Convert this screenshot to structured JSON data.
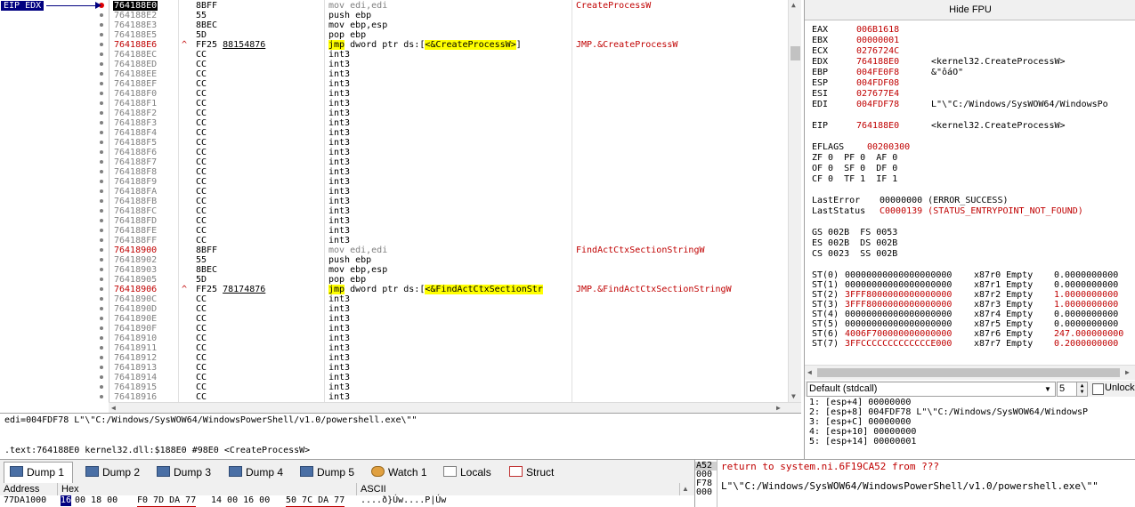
{
  "eip_tag": "EIP EDX",
  "disasm": [
    {
      "addr": "764188E0",
      "bytes": "8BFF",
      "instr": "mov edi,edi",
      "comment": "CreateProcessW",
      "cur": true,
      "bp": true,
      "gray": true
    },
    {
      "addr": "764188E2",
      "bytes": "55",
      "instr": "push ebp"
    },
    {
      "addr": "764188E3",
      "bytes": "8BEC",
      "instr": "mov ebp,esp"
    },
    {
      "addr": "764188E5",
      "bytes": "5D",
      "instr": "pop ebp"
    },
    {
      "addr": "764188E6",
      "bytes": "FF25 ",
      "bytes_ann": "88154876",
      "instr_kw": "jmp",
      "instr": " dword ptr ds:[",
      "instr_lbl": "<&CreateProcessW>",
      "instr_tail": "]",
      "comment": "JMP.&CreateProcessW",
      "jmp": true
    },
    {
      "addr": "764188EC",
      "bytes": "CC",
      "instr": "int3"
    },
    {
      "addr": "764188ED",
      "bytes": "CC",
      "instr": "int3"
    },
    {
      "addr": "764188EE",
      "bytes": "CC",
      "instr": "int3"
    },
    {
      "addr": "764188EF",
      "bytes": "CC",
      "instr": "int3"
    },
    {
      "addr": "764188F0",
      "bytes": "CC",
      "instr": "int3"
    },
    {
      "addr": "764188F1",
      "bytes": "CC",
      "instr": "int3"
    },
    {
      "addr": "764188F2",
      "bytes": "CC",
      "instr": "int3"
    },
    {
      "addr": "764188F3",
      "bytes": "CC",
      "instr": "int3"
    },
    {
      "addr": "764188F4",
      "bytes": "CC",
      "instr": "int3"
    },
    {
      "addr": "764188F5",
      "bytes": "CC",
      "instr": "int3"
    },
    {
      "addr": "764188F6",
      "bytes": "CC",
      "instr": "int3"
    },
    {
      "addr": "764188F7",
      "bytes": "CC",
      "instr": "int3"
    },
    {
      "addr": "764188F8",
      "bytes": "CC",
      "instr": "int3"
    },
    {
      "addr": "764188F9",
      "bytes": "CC",
      "instr": "int3"
    },
    {
      "addr": "764188FA",
      "bytes": "CC",
      "instr": "int3"
    },
    {
      "addr": "764188FB",
      "bytes": "CC",
      "instr": "int3"
    },
    {
      "addr": "764188FC",
      "bytes": "CC",
      "instr": "int3"
    },
    {
      "addr": "764188FD",
      "bytes": "CC",
      "instr": "int3"
    },
    {
      "addr": "764188FE",
      "bytes": "CC",
      "instr": "int3"
    },
    {
      "addr": "764188FF",
      "bytes": "CC",
      "instr": "int3"
    },
    {
      "addr": "76418900",
      "bytes": "8BFF",
      "instr": "mov edi,edi",
      "comment": "FindActCtxSectionStringW",
      "jmp": true,
      "gray": true
    },
    {
      "addr": "76418902",
      "bytes": "55",
      "instr": "push ebp"
    },
    {
      "addr": "76418903",
      "bytes": "8BEC",
      "instr": "mov ebp,esp"
    },
    {
      "addr": "76418905",
      "bytes": "5D",
      "instr": "pop ebp"
    },
    {
      "addr": "76418906",
      "bytes": "FF25 ",
      "bytes_ann": "78174876",
      "instr_kw": "jmp",
      "instr": " dword ptr ds:[",
      "instr_lbl": "<&FindActCtxSectionStr",
      "instr_tail": "",
      "comment": "JMP.&FindActCtxSectionStringW",
      "jmp": true
    },
    {
      "addr": "7641890C",
      "bytes": "CC",
      "instr": "int3"
    },
    {
      "addr": "7641890D",
      "bytes": "CC",
      "instr": "int3"
    },
    {
      "addr": "7641890E",
      "bytes": "CC",
      "instr": "int3"
    },
    {
      "addr": "7641890F",
      "bytes": "CC",
      "instr": "int3"
    },
    {
      "addr": "76418910",
      "bytes": "CC",
      "instr": "int3"
    },
    {
      "addr": "76418911",
      "bytes": "CC",
      "instr": "int3"
    },
    {
      "addr": "76418912",
      "bytes": "CC",
      "instr": "int3"
    },
    {
      "addr": "76418913",
      "bytes": "CC",
      "instr": "int3"
    },
    {
      "addr": "76418914",
      "bytes": "CC",
      "instr": "int3"
    },
    {
      "addr": "76418915",
      "bytes": "CC",
      "instr": "int3"
    },
    {
      "addr": "76418916",
      "bytes": "CC",
      "instr": "int3"
    }
  ],
  "info": {
    "line1": "edi=004FDF78 L\"\\\"C:/Windows/SysWOW64/WindowsPowerShell/v1.0/powershell.exe\\\"\"",
    "line2": ".text:764188E0 kernel32.dll:$188E0 #98E0 <CreateProcessW>"
  },
  "registers": {
    "hide_fpu": "Hide FPU",
    "gp": [
      {
        "name": "EAX",
        "value": "006B1618",
        "comment": ""
      },
      {
        "name": "EBX",
        "value": "00000001",
        "comment": ""
      },
      {
        "name": "ECX",
        "value": "0276724C",
        "comment": ""
      },
      {
        "name": "EDX",
        "value": "764188E0",
        "comment": "<kernel32.CreateProcessW>"
      },
      {
        "name": "EBP",
        "value": "004FE0F8",
        "comment": "&\"ôáO\""
      },
      {
        "name": "ESP",
        "value": "004FDF08",
        "comment": ""
      },
      {
        "name": "ESI",
        "value": "027677E4",
        "comment": ""
      },
      {
        "name": "EDI",
        "value": "004FDF78",
        "comment": "L\"\\\"C:/Windows/SysWOW64/WindowsPo"
      }
    ],
    "eip": {
      "name": "EIP",
      "value": "764188E0",
      "comment": "<kernel32.CreateProcessW>"
    },
    "eflags": {
      "name": "EFLAGS",
      "value": "00200300"
    },
    "flags": [
      "ZF 0  PF 0  AF 0",
      "OF 0  SF 0  DF 0",
      "CF 0  TF 1  IF 1"
    ],
    "lasterror_label": "LastError",
    "lasterror_value": "00000000 (ERROR_SUCCESS)",
    "laststatus_label": "LastStatus",
    "laststatus_value": "C0000139 (STATUS_ENTRYPOINT_NOT_FOUND)",
    "segs": [
      "GS 002B  FS 0053",
      "ES 002B  DS 002B",
      "CS 0023  SS 002B"
    ],
    "fpu": [
      {
        "name": "ST(0)",
        "value": "00000000000000000000",
        "tag": "x87r0 Empty",
        "num": "0.0000000000",
        "red": false
      },
      {
        "name": "ST(1)",
        "value": "00000000000000000000",
        "tag": "x87r1 Empty",
        "num": "0.0000000000",
        "red": false
      },
      {
        "name": "ST(2)",
        "value": "3FFF8000000000000000",
        "tag": "x87r2 Empty",
        "num": "1.0000000000",
        "red": true
      },
      {
        "name": "ST(3)",
        "value": "3FFF8000000000000000",
        "tag": "x87r3 Empty",
        "num": "1.0000000000",
        "red": true
      },
      {
        "name": "ST(4)",
        "value": "00000000000000000000",
        "tag": "x87r4 Empty",
        "num": "0.0000000000",
        "red": false
      },
      {
        "name": "ST(5)",
        "value": "00000000000000000000",
        "tag": "x87r5 Empty",
        "num": "0.0000000000",
        "red": false
      },
      {
        "name": "ST(6)",
        "value": "4006F700000000000000",
        "tag": "x87r6 Empty",
        "num": "247.000000000",
        "red": true
      },
      {
        "name": "ST(7)",
        "value": "3FFCCCCCCCCCCCCCE000",
        "tag": "x87r7 Empty",
        "num": "0.2000000000",
        "red": true
      }
    ]
  },
  "callstack": {
    "convention": "Default (stdcall)",
    "arg_count": "5",
    "unlock_label": "Unlock",
    "rows": [
      "1: [esp+4] 00000000",
      "2: [esp+8] 004FDF78 L\"\\\"C:/Windows/SysWOW64/WindowsP",
      "3: [esp+C] 00000000",
      "4: [esp+10] 00000000",
      "5: [esp+14] 00000001"
    ]
  },
  "tabs": [
    "Dump 1",
    "Dump 2",
    "Dump 3",
    "Dump 4",
    "Dump 5",
    "Watch 1",
    "Locals",
    "Struct"
  ],
  "dump": {
    "col_address": "Address",
    "col_hex": "Hex",
    "col_ascii": "ASCII",
    "row_addr": "77DA1000",
    "hex_groups": [
      "16 00 18 00",
      "F0 7D DA 77",
      "14 00 16 00",
      "50 7C DA 77"
    ],
    "ascii": "....ð}Úw....P|Úw"
  },
  "stack": {
    "addr_lines": [
      "A52",
      "000",
      "F78",
      "000"
    ],
    "return_text": "return to system.ni.6F19CA52 from ???",
    "string_text": "L\"\\\"C:/Windows/SysWOW64/WindowsPowerShell/v1.0/powershell.exe\\\"\""
  }
}
